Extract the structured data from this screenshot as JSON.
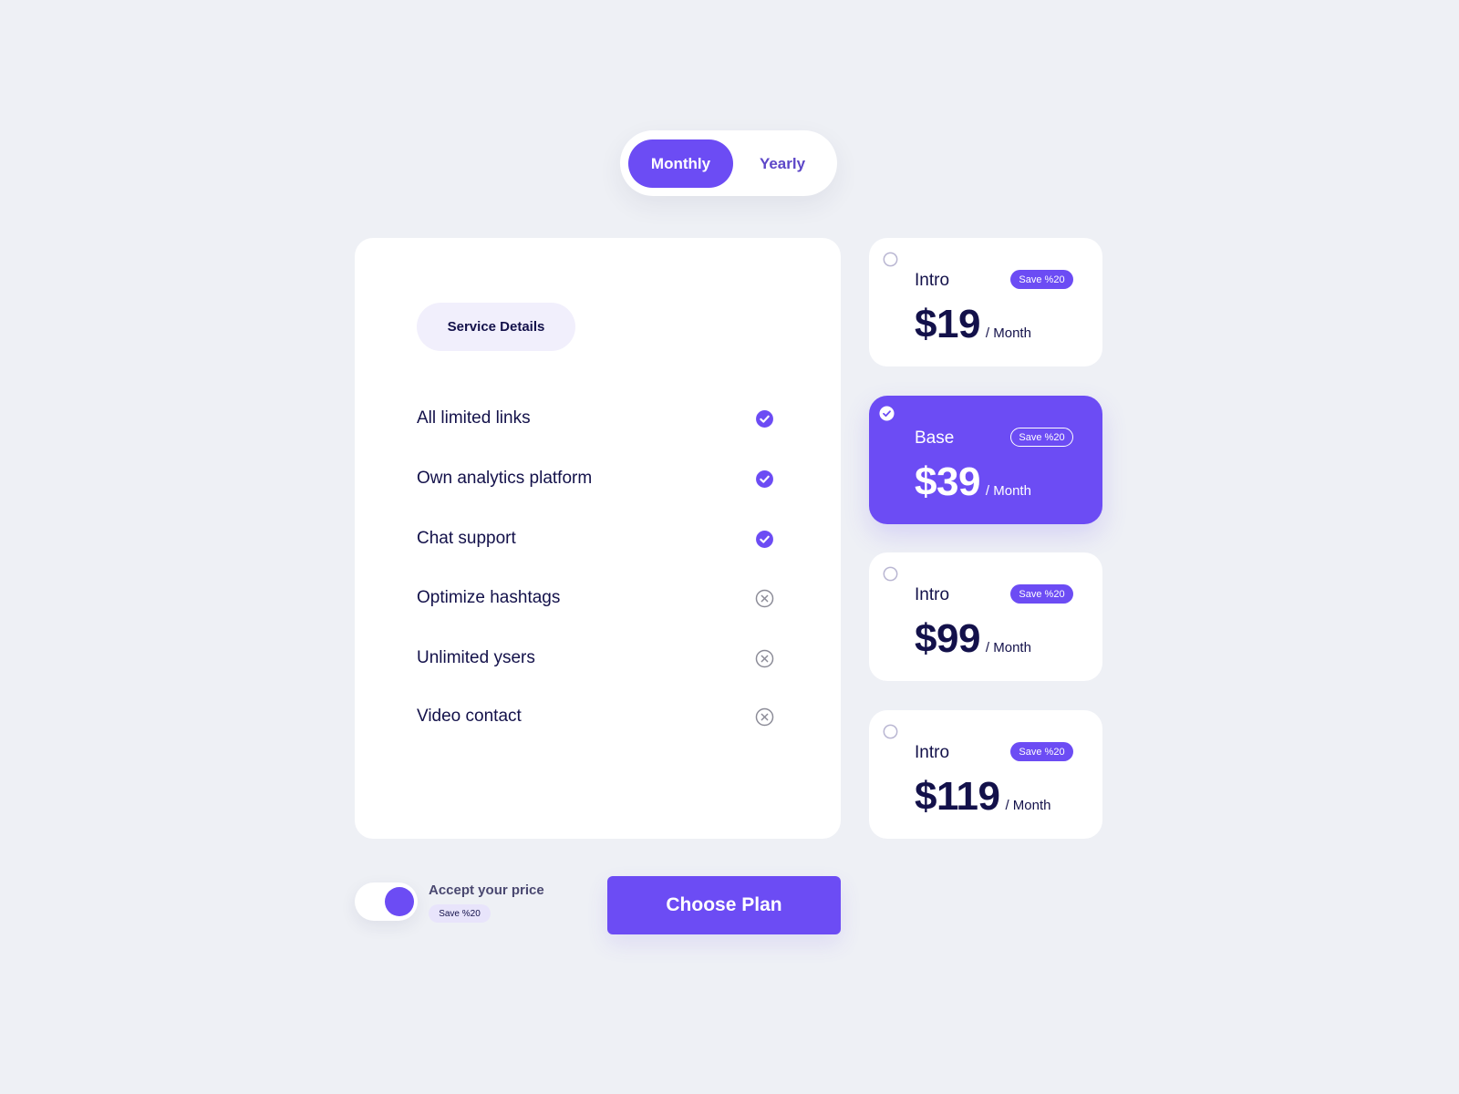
{
  "billing_toggle": {
    "options": [
      {
        "label": "Monthly",
        "active": true
      },
      {
        "label": "Yearly",
        "active": false
      }
    ]
  },
  "service_details": {
    "label": "Service Details",
    "features": [
      {
        "label": "All limited links",
        "included": true
      },
      {
        "label": "Own analytics platform",
        "included": true
      },
      {
        "label": "Chat support",
        "included": true
      },
      {
        "label": "Optimize hashtags",
        "included": false
      },
      {
        "label": "Unlimited ysers",
        "included": false
      },
      {
        "label": "Video contact",
        "included": false
      }
    ]
  },
  "plans": [
    {
      "name": "Intro",
      "badge": "Save %20",
      "price": "$19",
      "period": "/ Month",
      "selected": false
    },
    {
      "name": "Base",
      "badge": "Save %20",
      "price": "$39",
      "period": "/ Month",
      "selected": true
    },
    {
      "name": "Intro",
      "badge": "Save %20",
      "price": "$99",
      "period": "/ Month",
      "selected": false
    },
    {
      "name": "Intro",
      "badge": "Save %20",
      "price": "$119",
      "period": "/ Month",
      "selected": false
    }
  ],
  "accept_price": {
    "label": "Accept your price",
    "badge": "Save %20",
    "enabled": true
  },
  "choose_plan_label": "Choose Plan",
  "colors": {
    "accent": "#6c4cf4",
    "text_dark": "#13114a",
    "background": "#eef0f5",
    "card": "#ffffff"
  },
  "icons": {
    "included": "check-circle-icon",
    "excluded": "x-circle-icon",
    "plan_unselected": "radio-empty-icon",
    "plan_selected": "radio-check-icon"
  }
}
